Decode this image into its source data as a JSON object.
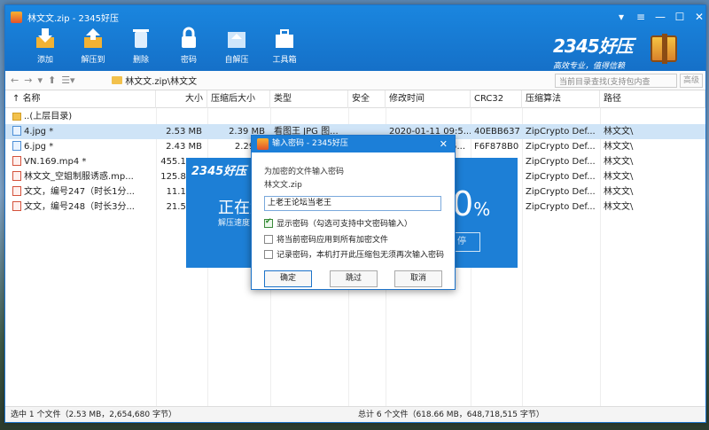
{
  "window": {
    "title": "林文文.zip - 2345好压"
  },
  "toolbar": [
    {
      "label": "添加",
      "icon": "add-icon"
    },
    {
      "label": "解压到",
      "icon": "extract-icon"
    },
    {
      "label": "删除",
      "icon": "trash-icon"
    },
    {
      "label": "密码",
      "icon": "lock-icon"
    },
    {
      "label": "自解压",
      "icon": "selfextract-icon"
    },
    {
      "label": "工具箱",
      "icon": "toolbox-icon"
    }
  ],
  "brand": {
    "name": "2345好压",
    "slogan": "高效专业，值得信赖"
  },
  "address": {
    "path": "林文文.zip\\林文文",
    "search_placeholder": "当前目录查找(支持包内查",
    "go_label": "高级"
  },
  "columns": [
    "名称",
    "大小",
    "压缩后大小",
    "类型",
    "安全",
    "修改时间",
    "CRC32",
    "压缩算法",
    "路径"
  ],
  "files": [
    {
      "name": "..(上层目录)",
      "size": "",
      "packed": "",
      "type": "",
      "mtime": "",
      "crc": "",
      "method": "",
      "path": "",
      "icon": "up"
    },
    {
      "name": "4.jpg *",
      "size": "2.53 MB",
      "packed": "2.39 MB",
      "type": "看图王 JPG 图...",
      "mtime": "2020-01-11 09:5...",
      "crc": "40EBB637",
      "method": "ZipCrypto Def...",
      "path": "林文文\\",
      "icon": "img"
    },
    {
      "name": "6.jpg *",
      "size": "2.43 MB",
      "packed": "2.29 M",
      "type": "",
      "mtime": "5...",
      "crc": "F6F878B0",
      "method": "ZipCrypto Def...",
      "path": "林文文\\",
      "icon": "img"
    },
    {
      "name": "VN.169.mp4 *",
      "size": "455.13 M",
      "packed": "",
      "type": "",
      "mtime": "",
      "crc": "",
      "method": "ZipCrypto Def...",
      "path": "林文文\\",
      "icon": "vid"
    },
    {
      "name": "林文文_空姐制服诱惑.mp...",
      "size": "125.88 M",
      "packed": "",
      "type": "",
      "mtime": "",
      "crc": "",
      "method": "ZipCrypto Def...",
      "path": "林文文\\",
      "icon": "vid"
    },
    {
      "name": "文文，编号247（时长1分...",
      "size": "11.11 M",
      "packed": "",
      "type": "",
      "mtime": "",
      "crc": "",
      "method": "ZipCrypto Def...",
      "path": "林文文\\",
      "icon": "vid"
    },
    {
      "name": "文文，编号248（时长3分...",
      "size": "21.56 M",
      "packed": "",
      "type": "",
      "mtime": "",
      "crc": "",
      "method": "ZipCrypto Def...",
      "path": "林文文\\",
      "icon": "vid"
    }
  ],
  "status": {
    "left": "选中 1 个文件（2.53 MB，2,654,680 字节）",
    "right": "总计 6 个文件（618.66 MB，648,718,515 字节）"
  },
  "progress": {
    "logo": "2345好压",
    "label": "正在解",
    "sub": "解压速度",
    "percent": "0",
    "unit": "%",
    "button": "停"
  },
  "dialog": {
    "title": "输入密码 - 2345好压",
    "prompt": "为加密的文件输入密码",
    "archive": "林文文.zip",
    "password": "上老王论坛当老王",
    "opt1": "显示密码（勾选可支持中文密码输入）",
    "opt2": "将当前密码应用到所有加密文件",
    "opt3": "记录密码，本机打开此压缩包无须再次输入密码",
    "ok": "确定",
    "skip": "跳过",
    "cancel": "取消"
  }
}
